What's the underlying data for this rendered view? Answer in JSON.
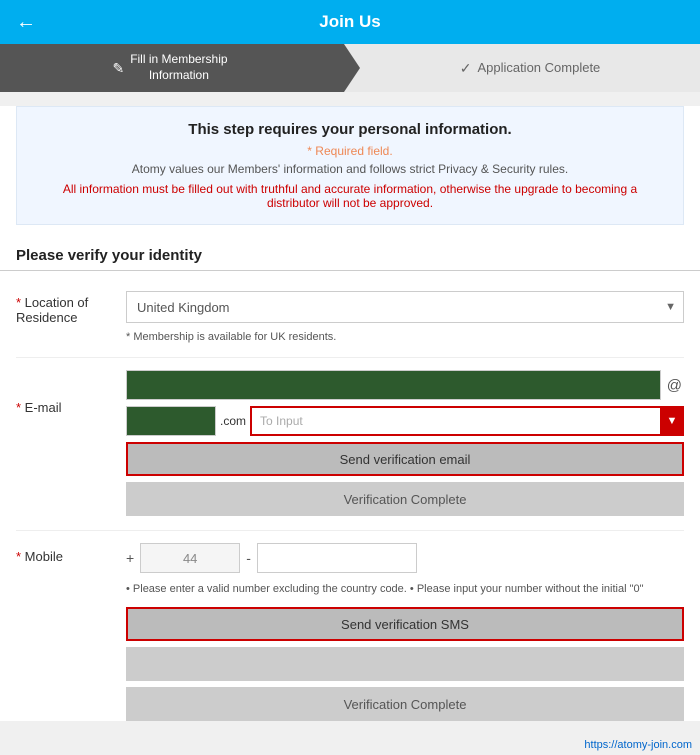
{
  "header": {
    "title": "Join Us",
    "back_label": "←"
  },
  "steps": [
    {
      "id": "fill",
      "icon": "✎",
      "label": "Fill in Membership\nInformation",
      "active": true
    },
    {
      "id": "complete",
      "icon": "✓",
      "label": "Application Complete",
      "active": false
    }
  ],
  "info_box": {
    "title": "This step requires your personal information.",
    "required_label": "* Required field.",
    "privacy_text": "Atomy values our Members' information and follows strict Privacy & Security rules.",
    "warning_text": "All information must be filled out with truthful and accurate information, otherwise the upgrade to becoming a distributor will not be approved."
  },
  "section_title": "Please verify your identity",
  "form": {
    "location_label": "* Location of\nResidence",
    "location_value": "United Kingdom",
    "location_hint": "* Membership is available for UK residents.",
    "email_label": "* E-mail",
    "email_first_value": "██████████",
    "email_domain_value": "████",
    "email_domain_suffix": ".com",
    "email_domain_placeholder": "To Input",
    "send_email_btn": "Send verification email",
    "verification_complete_btn": "Verification Complete",
    "mobile_label": "* Mobile",
    "phone_plus": "+",
    "phone_code": "44",
    "phone_dash": "-",
    "phone_hint": "• Please enter a valid number excluding the country code. • Please input your number without the initial \"0\"",
    "send_sms_btn": "Send verification SMS",
    "sms_verification_complete_btn": "Verification Complete"
  },
  "footer": {
    "watermark": "https://atomy-join.com"
  }
}
